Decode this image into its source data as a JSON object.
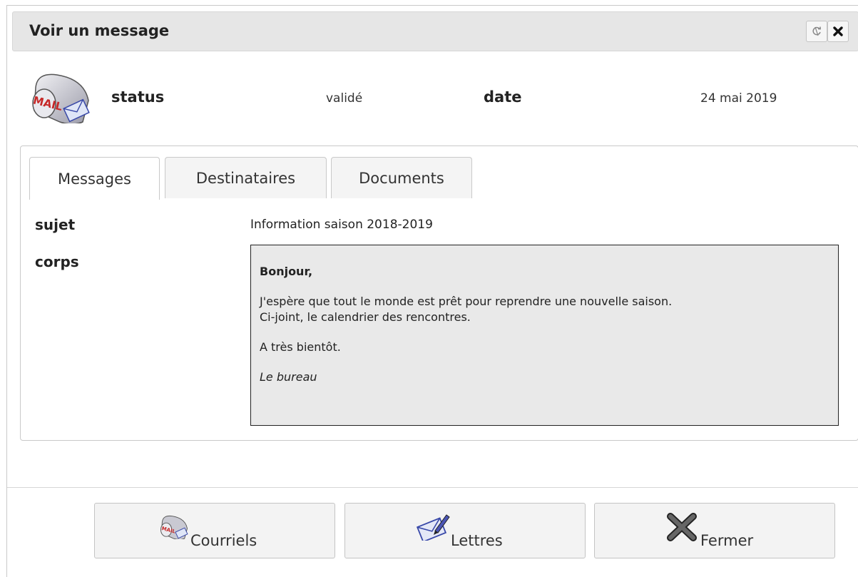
{
  "dialog": {
    "title": "Voir un message",
    "refresh_icon": "refresh-icon",
    "close_icon": "close-icon"
  },
  "header": {
    "icon": "mailbox-icon",
    "status_label": "status",
    "status_value": "validé",
    "date_label": "date",
    "date_value": "24 mai 2019"
  },
  "tabs": [
    {
      "label": "Messages",
      "active": true
    },
    {
      "label": "Destinataires",
      "active": false
    },
    {
      "label": "Documents",
      "active": false
    }
  ],
  "message": {
    "subject_label": "sujet",
    "subject_value": "Information saison 2018-2019",
    "body_label": "corps",
    "body": {
      "greeting": "Bonjour,",
      "line1": "J'espère que tout le monde est prêt pour reprendre une nouvelle saison.",
      "line2": "Ci-joint, le calendrier des rencontres.",
      "closing": "A très bientôt.",
      "signature": "Le bureau"
    }
  },
  "footer_buttons": [
    {
      "label": "Courriels",
      "icon": "mailbox-icon"
    },
    {
      "label": "Lettres",
      "icon": "letter-icon"
    },
    {
      "label": "Fermer",
      "icon": "close-x-icon"
    }
  ]
}
